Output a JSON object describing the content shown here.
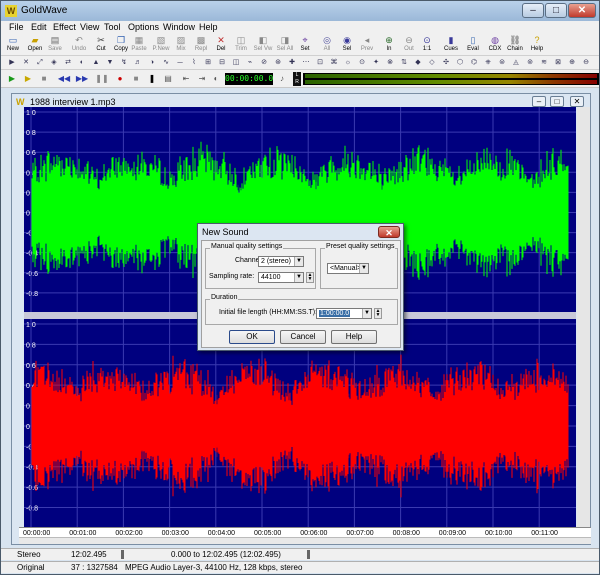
{
  "app": {
    "title": "GoldWave",
    "icon": "goldwave-logo-icon"
  },
  "menu": [
    "File",
    "Edit",
    "Effect",
    "View",
    "Tool",
    "Options",
    "Window",
    "Help"
  ],
  "toolbar": [
    {
      "label": "New",
      "icon": "new-icon",
      "enabled": true
    },
    {
      "label": "Open",
      "icon": "open-folder-icon",
      "enabled": true
    },
    {
      "label": "Save",
      "icon": "save-icon",
      "enabled": false
    },
    {
      "label": "Undo",
      "icon": "undo-icon",
      "enabled": false
    },
    {
      "label": "Cut",
      "icon": "cut-icon",
      "enabled": true
    },
    {
      "label": "Copy",
      "icon": "copy-icon",
      "enabled": true
    },
    {
      "label": "Paste",
      "icon": "paste-icon",
      "enabled": false
    },
    {
      "label": "P.New",
      "icon": "paste-new-icon",
      "enabled": false
    },
    {
      "label": "Mix",
      "icon": "mix-icon",
      "enabled": false
    },
    {
      "label": "Repl",
      "icon": "replace-icon",
      "enabled": false
    },
    {
      "label": "Del",
      "icon": "delete-icon",
      "enabled": true
    },
    {
      "label": "Trim",
      "icon": "trim-icon",
      "enabled": false
    },
    {
      "label": "Sel Vw",
      "icon": "select-view-icon",
      "enabled": false
    },
    {
      "label": "Sel All",
      "icon": "select-all-icon",
      "enabled": false
    },
    {
      "label": "Set",
      "icon": "set-icon",
      "enabled": true
    },
    {
      "label": "All",
      "icon": "view-all-icon",
      "enabled": false
    },
    {
      "label": "Sel",
      "icon": "view-selection-icon",
      "enabled": true
    },
    {
      "label": "Prev",
      "icon": "previous-icon",
      "enabled": false
    },
    {
      "label": "In",
      "icon": "zoom-in-icon",
      "enabled": true
    },
    {
      "label": "Out",
      "icon": "zoom-out-icon",
      "enabled": false
    },
    {
      "label": "1:1",
      "icon": "zoom-one-to-one-icon",
      "enabled": true
    },
    {
      "label": "Cues",
      "icon": "cues-icon",
      "enabled": true
    },
    {
      "label": "Eval",
      "icon": "eval-icon",
      "enabled": true
    },
    {
      "label": "CDX",
      "icon": "cd-icon",
      "enabled": true
    },
    {
      "label": "Chain",
      "icon": "chain-icon",
      "enabled": true
    },
    {
      "label": "Help",
      "icon": "help-book-icon",
      "enabled": true
    }
  ],
  "transport": {
    "time": "00:00:00.0",
    "lr_label": "L\nR"
  },
  "document": {
    "title": "1988 interview 1.mp3",
    "scale_labels": [
      "1.0",
      "0.8",
      "0.6",
      "0.4",
      "0.2",
      "0.0",
      "-0.2",
      "-0.4",
      "-0.6",
      "-0.8"
    ],
    "channel_colors": {
      "left": "#00ff00",
      "right": "#ff0000",
      "background": "#00007f",
      "grid": "#3a3ab0"
    },
    "time_ticks": [
      "00:00:00",
      "00:01:00",
      "00:02:00",
      "00:03:00",
      "00:04:00",
      "00:05:00",
      "00:06:00",
      "00:07:00",
      "00:08:00",
      "00:09:00",
      "00:10:00",
      "00:11:00"
    ]
  },
  "status": {
    "channels": "Stereo",
    "length": "12:02.495",
    "selection": "0.000 to 12:02.495 (12:02.495)",
    "mode": "Original",
    "ratio": "37 : 1327584",
    "format": "MPEG Audio Layer-3, 44100 Hz, 128 kbps, stereo"
  },
  "dialog": {
    "title": "New Sound",
    "manual_group": "Manual quality settings",
    "channels_label": "Channels:",
    "channels_value": "2 (stereo)",
    "rate_label": "Sampling rate:",
    "rate_value": "44100",
    "preset_group": "Preset quality settings",
    "preset_value": "<Manual>",
    "duration_group": "Duration",
    "length_label": "Initial file length (HH:MM:SS.T):",
    "length_value": "1:00:00.0",
    "ok": "OK",
    "cancel": "Cancel",
    "help": "Help"
  }
}
